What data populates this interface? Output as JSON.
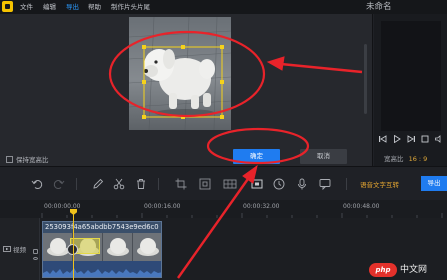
{
  "menubar": {
    "items": [
      "文件",
      "编辑",
      "导出",
      "帮助",
      "制作片头片尾"
    ],
    "active_index": 2,
    "title": "未命名"
  },
  "dialog": {
    "keep_ratio_label": "保持宽高比",
    "keep_ratio_checked": false,
    "ok_label": "确定",
    "cancel_label": "取消"
  },
  "preview": {
    "ratio_label": "宽高比",
    "ratio_value": "16 : 9"
  },
  "toolbar": {
    "icons": [
      "undo-icon",
      "redo-icon",
      "pen-icon",
      "scissors-icon",
      "trash-icon",
      "crop-icon",
      "resize-icon",
      "mosaic-icon",
      "freeze-frame-icon",
      "speed-icon",
      "microphone-icon",
      "text-to-speech-icon"
    ],
    "speech_label": "语音文字互转",
    "export_label": "导出"
  },
  "timeline": {
    "ticks": [
      "00:00:00.00",
      "00:00:16.00",
      "00:00:32.00",
      "00:00:48.00"
    ],
    "track_name": "视频",
    "clip_name": "253093f4a65abdbb7543e9ed6c0"
  },
  "watermark": {
    "logo": "php",
    "site": "中文网"
  },
  "colors": {
    "accent": "#1f7cf0",
    "annotation": "#e8232a",
    "crop_handle": "#f5d21b",
    "playhead": "#f0c21b",
    "ratio_value": "#e0a93a"
  }
}
